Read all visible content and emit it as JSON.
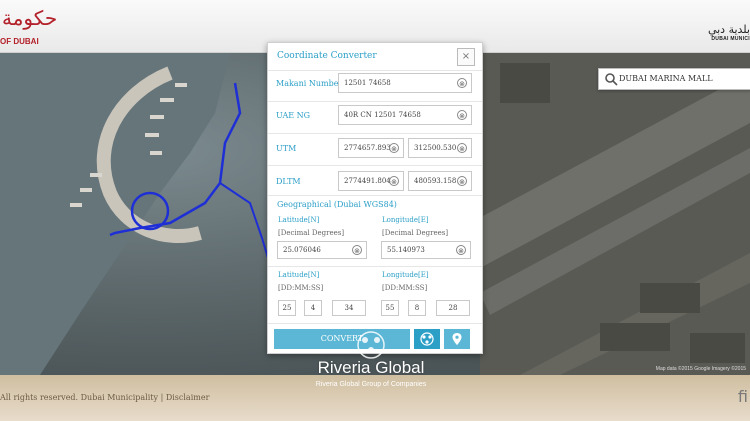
{
  "header": {
    "left_logo_arabic": "حكومة",
    "left_logo_text": "OF DUBAI",
    "right_logo_arabic": "بلدية دبي",
    "right_logo_text": "DUBAI MUNICI"
  },
  "search": {
    "value": "DUBAI MARINA MALL"
  },
  "map": {
    "credit": "Map data ©2015 Google Imagery ©2015"
  },
  "dialog": {
    "title": "Coordinate Converter",
    "close_glyph": "×",
    "clear_glyph": "⊗",
    "rows": [
      {
        "label": "Makani Number",
        "fields": [
          "12501 74658"
        ]
      },
      {
        "label": "UAE NG",
        "fields": [
          "40R CN 12501 74658"
        ]
      },
      {
        "label": "UTM",
        "fields": [
          "2774657.893",
          "312500.530"
        ]
      },
      {
        "label": "DLTM",
        "fields": [
          "2774491.804",
          "480593.158"
        ]
      }
    ],
    "geo_title": "Geographical (Dubai WGS84)",
    "latitude_label": "Latitude[N]",
    "longitude_label": "Longitude[E]",
    "decimal_label": "[Decimal Degrees]",
    "dms_label": "[DD:MM:SS]",
    "lat_decimal": "25.076046",
    "lon_decimal": "55.140973",
    "lat_dms": [
      "25",
      "4",
      "34"
    ],
    "lon_dms": [
      "55",
      "8",
      "28"
    ],
    "convert_label": "CONVERT"
  },
  "footer": {
    "text": "All rights reserved. Dubai Municipality | Disclaimer",
    "right_glyph": "fi"
  },
  "watermark": {
    "name": "Riveria Global",
    "sub": "Riveria Global Group of Companies"
  }
}
